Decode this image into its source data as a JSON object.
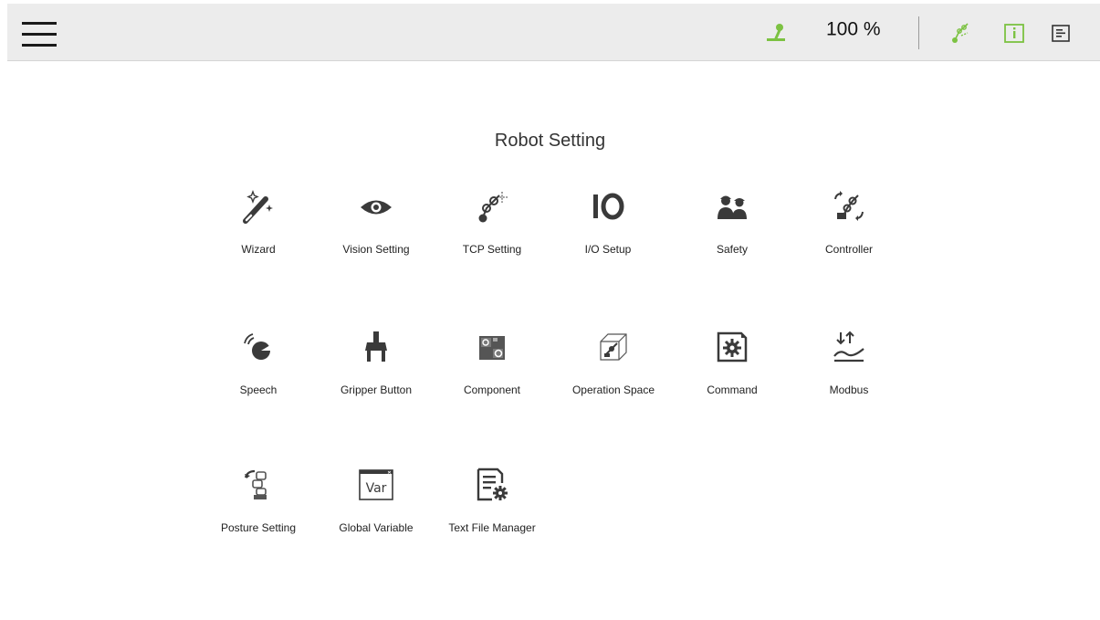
{
  "header": {
    "speed": "100 %",
    "icons": [
      "robot-status-icon",
      "arm-connect-icon",
      "info-icon",
      "log-icon"
    ],
    "accent_color": "#7cc242"
  },
  "main": {
    "title": "Robot Setting",
    "items": [
      {
        "label": "Wizard",
        "icon": "wand-icon"
      },
      {
        "label": "Vision Setting",
        "icon": "eye-icon"
      },
      {
        "label": "TCP Setting",
        "icon": "tcp-icon"
      },
      {
        "label": "I/O Setup",
        "icon": "io-icon"
      },
      {
        "label": "Safety",
        "icon": "safety-icon"
      },
      {
        "label": "Controller",
        "icon": "controller-icon"
      },
      {
        "label": "Speech",
        "icon": "speech-icon"
      },
      {
        "label": "Gripper Button",
        "icon": "gripper-icon"
      },
      {
        "label": "Component",
        "icon": "component-icon"
      },
      {
        "label": "Operation Space",
        "icon": "operation-space-icon"
      },
      {
        "label": "Command",
        "icon": "command-icon"
      },
      {
        "label": "Modbus",
        "icon": "modbus-icon"
      },
      {
        "label": "Posture Setting",
        "icon": "posture-icon"
      },
      {
        "label": "Global Variable",
        "icon": "global-variable-icon"
      },
      {
        "label": "Text File Manager",
        "icon": "text-file-manager-icon"
      }
    ]
  }
}
